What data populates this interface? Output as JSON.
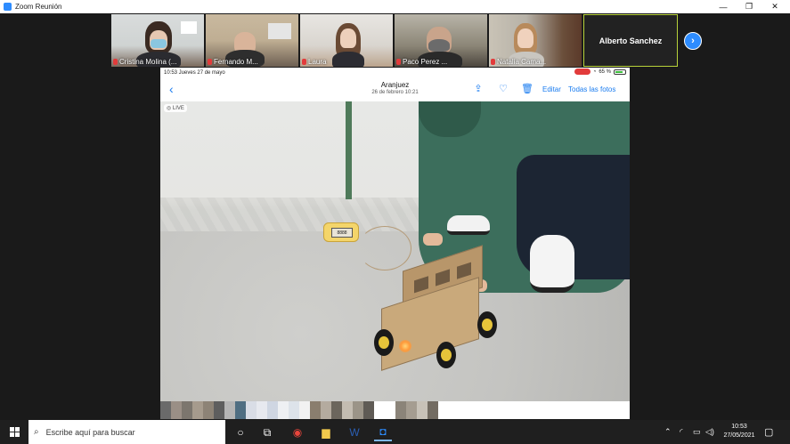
{
  "window": {
    "title": "Zoom Reunión",
    "minimize": "—",
    "maximize": "❐",
    "close": "✕"
  },
  "participants": [
    {
      "name": "Cristina Molina (...",
      "muted": true
    },
    {
      "name": "Fernando M...",
      "muted": true
    },
    {
      "name": "Laura",
      "muted": true
    },
    {
      "name": "Paco Perez ...",
      "muted": true
    },
    {
      "name": "Natalia Cama...",
      "muted": true
    }
  ],
  "name_only_tile": "Alberto Sanchez",
  "next_page": "›",
  "ipad": {
    "status_left": "10:53   Jueves 27 de mayo",
    "battery": "65 %",
    "nav_title": "Aranjuez",
    "nav_subtitle": "26 de febrero  10:21",
    "edit": "Editar",
    "all_photos": "Todas las fotos",
    "live_badge": "LIVE",
    "device_screen": "8888"
  },
  "taskbar": {
    "search_placeholder": "Escribe aquí para buscar",
    "time": "10:53",
    "date": "27/05/2021"
  },
  "colors": {
    "zoom_blue": "#2d8cff",
    "ios_blue": "#1a7cf0",
    "active_speaker_border": "#b7d23a",
    "hoodie_green": "#3c6e5c"
  }
}
